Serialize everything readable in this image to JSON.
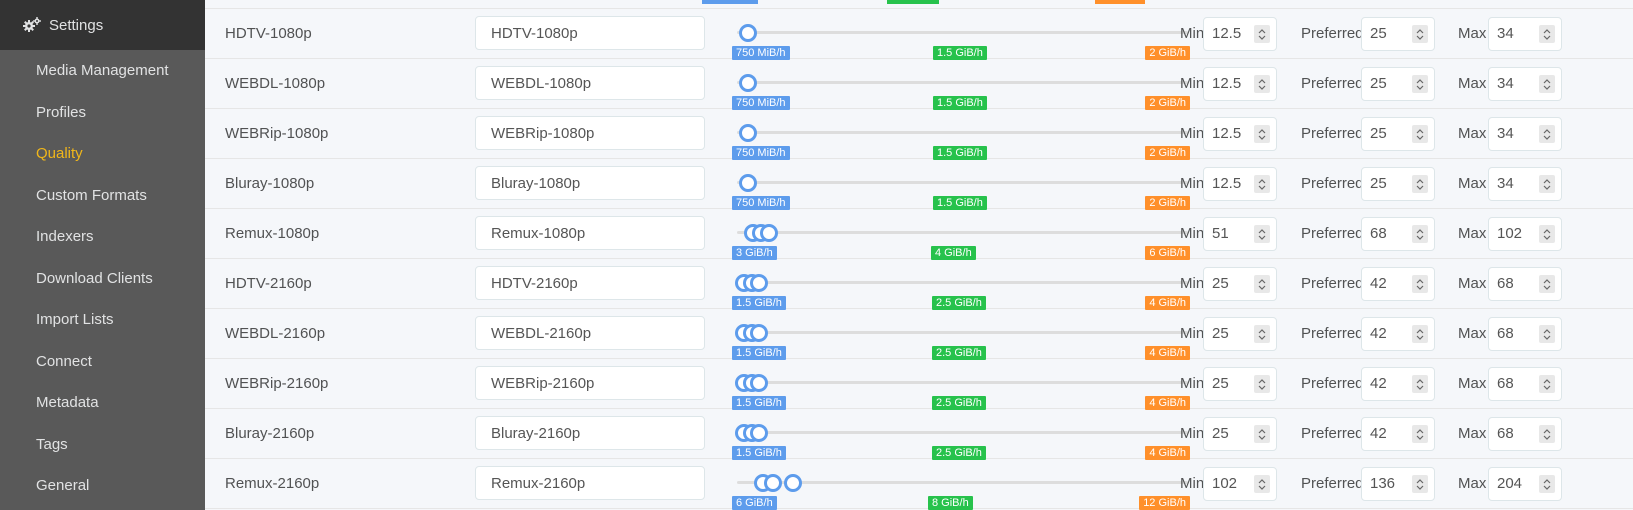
{
  "sidebar": {
    "section_label": "Settings",
    "section_icon": "gears-icon",
    "items": [
      {
        "label": "Media Management",
        "active": false
      },
      {
        "label": "Profiles",
        "active": false
      },
      {
        "label": "Quality",
        "active": true
      },
      {
        "label": "Custom Formats",
        "active": false
      },
      {
        "label": "Indexers",
        "active": false
      },
      {
        "label": "Download Clients",
        "active": false
      },
      {
        "label": "Import Lists",
        "active": false
      },
      {
        "label": "Connect",
        "active": false
      },
      {
        "label": "Metadata",
        "active": false
      },
      {
        "label": "Tags",
        "active": false
      },
      {
        "label": "General",
        "active": false
      }
    ]
  },
  "labels": {
    "min": "Min",
    "preferred": "Preferred",
    "max": "Max"
  },
  "colors": {
    "min_label": "#5d9cec",
    "preferred_label": "#27c24c",
    "max_label": "#ff902b",
    "active_nav": "#f0b61a"
  },
  "rows": [
    {
      "name": "HDTV-1080p",
      "title": "HDTV-1080p",
      "min": "12.5",
      "preferred": "25",
      "max": "34",
      "min_rate": "750 MiB/h",
      "preferred_rate": "1.5 GiB/h",
      "max_rate": "2 GiB/h"
    },
    {
      "name": "WEBDL-1080p",
      "title": "WEBDL-1080p",
      "min": "12.5",
      "preferred": "25",
      "max": "34",
      "min_rate": "750 MiB/h",
      "preferred_rate": "1.5 GiB/h",
      "max_rate": "2 GiB/h"
    },
    {
      "name": "WEBRip-1080p",
      "title": "WEBRip-1080p",
      "min": "12.5",
      "preferred": "25",
      "max": "34",
      "min_rate": "750 MiB/h",
      "preferred_rate": "1.5 GiB/h",
      "max_rate": "2 GiB/h"
    },
    {
      "name": "Bluray-1080p",
      "title": "Bluray-1080p",
      "min": "12.5",
      "preferred": "25",
      "max": "34",
      "min_rate": "750 MiB/h",
      "preferred_rate": "1.5 GiB/h",
      "max_rate": "2 GiB/h"
    },
    {
      "name": "Remux-1080p",
      "title": "Remux-1080p",
      "min": "51",
      "preferred": "68",
      "max": "102",
      "min_rate": "3 GiB/h",
      "preferred_rate": "4 GiB/h",
      "max_rate": "6 GiB/h"
    },
    {
      "name": "HDTV-2160p",
      "title": "HDTV-2160p",
      "min": "25",
      "preferred": "42",
      "max": "68",
      "min_rate": "1.5 GiB/h",
      "preferred_rate": "2.5 GiB/h",
      "max_rate": "4 GiB/h"
    },
    {
      "name": "WEBDL-2160p",
      "title": "WEBDL-2160p",
      "min": "25",
      "preferred": "42",
      "max": "68",
      "min_rate": "1.5 GiB/h",
      "preferred_rate": "2.5 GiB/h",
      "max_rate": "4 GiB/h"
    },
    {
      "name": "WEBRip-2160p",
      "title": "WEBRip-2160p",
      "min": "25",
      "preferred": "42",
      "max": "68",
      "min_rate": "1.5 GiB/h",
      "preferred_rate": "2.5 GiB/h",
      "max_rate": "4 GiB/h"
    },
    {
      "name": "Bluray-2160p",
      "title": "Bluray-2160p",
      "min": "25",
      "preferred": "42",
      "max": "68",
      "min_rate": "1.5 GiB/h",
      "preferred_rate": "2.5 GiB/h",
      "max_rate": "4 GiB/h"
    },
    {
      "name": "Remux-2160p",
      "title": "Remux-2160p",
      "min": "102",
      "preferred": "136",
      "max": "204",
      "min_rate": "6 GiB/h",
      "preferred_rate": "8 GiB/h",
      "max_rate": "12 GiB/h"
    }
  ]
}
